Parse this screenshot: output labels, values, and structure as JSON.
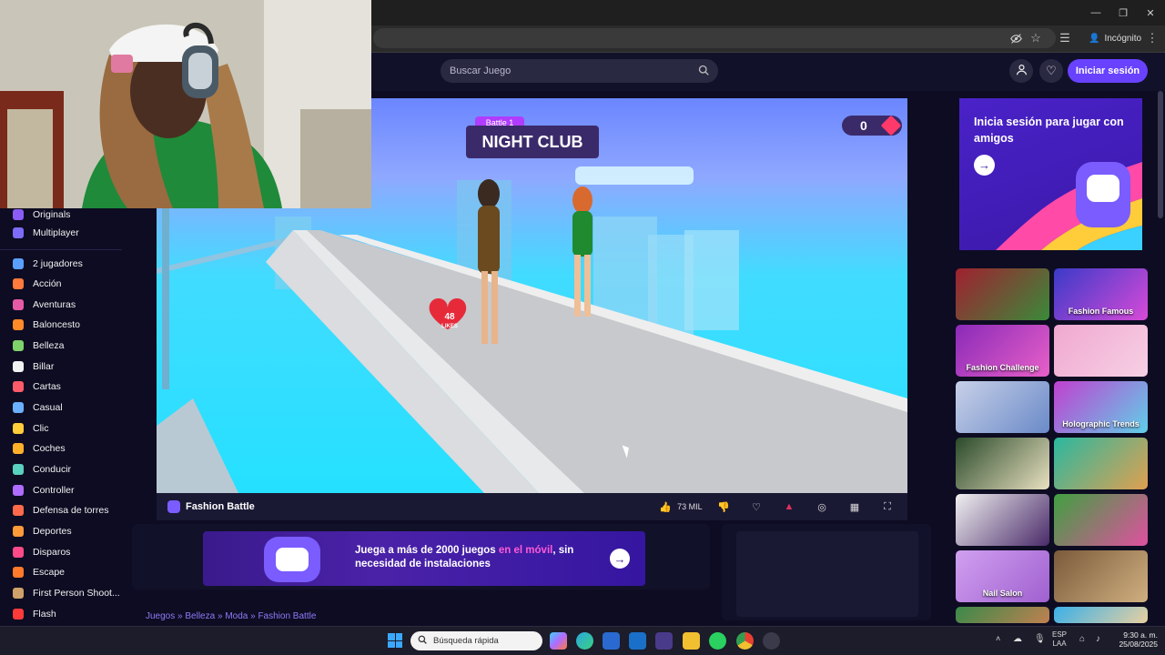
{
  "browser": {
    "incognito_label": "Incógnito",
    "window_buttons": [
      "—",
      "❐",
      "✕"
    ]
  },
  "header": {
    "search_placeholder": "Buscar Juego",
    "login_label": "Iniciar sesión"
  },
  "sidebar": {
    "items": [
      {
        "label": "Originals",
        "color": "#8b5cf6"
      },
      {
        "label": "Multiplayer",
        "color": "#7c6cf8"
      },
      {
        "label": "2 jugadores",
        "color": "#5aa0ff"
      },
      {
        "label": "Acción",
        "color": "#ff7a3d"
      },
      {
        "label": "Aventuras",
        "color": "#e85aa6"
      },
      {
        "label": "Baloncesto",
        "color": "#ff8a2a"
      },
      {
        "label": "Belleza",
        "color": "#7fd36b"
      },
      {
        "label": "Billar",
        "color": "#f2f2f2"
      },
      {
        "label": "Cartas",
        "color": "#ff5a6a"
      },
      {
        "label": "Casual",
        "color": "#6ab0ff"
      },
      {
        "label": "Clic",
        "color": "#ffcc3a"
      },
      {
        "label": "Coches",
        "color": "#ffb02a"
      },
      {
        "label": "Conducir",
        "color": "#5ad0c0"
      },
      {
        "label": "Controller",
        "color": "#b06bff"
      },
      {
        "label": "Defensa de torres",
        "color": "#ff6a4a"
      },
      {
        "label": "Deportes",
        "color": "#ff9a3a"
      },
      {
        "label": "Disparos",
        "color": "#ff4a8a"
      },
      {
        "label": "Escape",
        "color": "#ff7a2a"
      },
      {
        "label": "First Person Shoot...",
        "color": "#d0a06a"
      },
      {
        "label": "Flash",
        "color": "#ff3a3a"
      }
    ]
  },
  "game": {
    "battle_label": "Battle 1",
    "stage_title": "NIGHT CLUB",
    "score": "0",
    "heart_number": "48",
    "heart_label": "LIKES"
  },
  "gamebar": {
    "title": "Fashion Battle",
    "likes": "73 MIL"
  },
  "banner": {
    "text_part1": "Juega a más de 2000 juegos ",
    "text_highlight": "en el móvil",
    "text_part2": ", sin necesidad de instalaciones"
  },
  "breadcrumb": {
    "items": [
      "Juegos",
      "Belleza",
      "Moda",
      "Fashion Battle"
    ],
    "separator": "»"
  },
  "promo": {
    "text": "Inicia sesión para jugar con amigos"
  },
  "thumbnails": [
    {
      "label": "",
      "c1": "#a02030",
      "c2": "#3a8a3a"
    },
    {
      "label": "Fashion Famous",
      "c1": "#3a3ac8",
      "c2": "#d84ad8"
    },
    {
      "label": "Fashion Challenge",
      "c1": "#8a2ab8",
      "c2": "#e860c8"
    },
    {
      "label": "",
      "c1": "#f0a8d0",
      "c2": "#f7d0e4"
    },
    {
      "label": "",
      "c1": "#c8d0e8",
      "c2": "#6a8ac8"
    },
    {
      "label": "Holographic Trends",
      "c1": "#c040d0",
      "c2": "#60d0e8"
    },
    {
      "label": "",
      "c1": "#2a4a2a",
      "c2": "#e8e0c0"
    },
    {
      "label": "",
      "c1": "#2ab8a0",
      "c2": "#e0a050"
    },
    {
      "label": "",
      "c1": "#f0f0f0",
      "c2": "#4a2a6a"
    },
    {
      "label": "",
      "c1": "#40a040",
      "c2": "#e050a0"
    },
    {
      "label": "Nail Salon",
      "c1": "#d0a0f0",
      "c2": "#a060d0"
    },
    {
      "label": "",
      "c1": "#7a5a3a",
      "c2": "#d0b080"
    },
    {
      "label": "",
      "c1": "#3a8a4a",
      "c2": "#c08050"
    },
    {
      "label": "",
      "c1": "#3ab0e8",
      "c2": "#e8d0a0"
    }
  ],
  "taskbar": {
    "search_placeholder": "Búsqueda rápida",
    "language": "ESP",
    "region": "LAA",
    "time": "9:30 a. m.",
    "date": "25/08/2025"
  }
}
